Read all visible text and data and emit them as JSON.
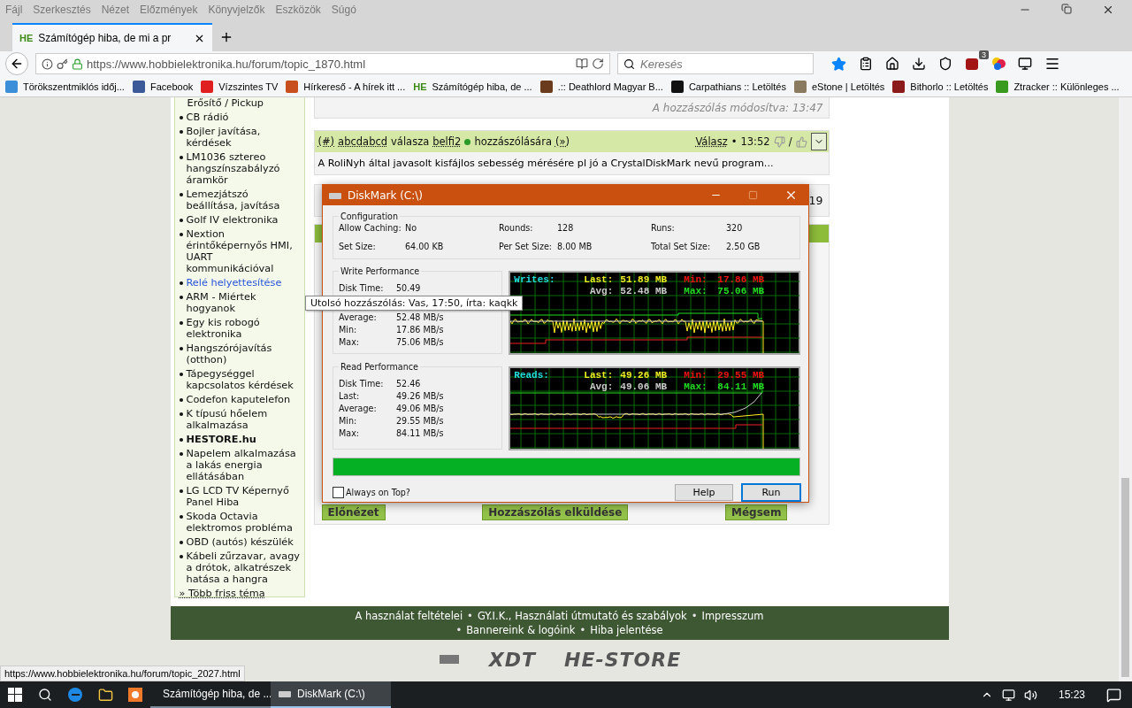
{
  "menu": [
    "Fájl",
    "Szerkesztés",
    "Nézet",
    "Előzmények",
    "Könyvjelzők",
    "Eszközök",
    "Súgó"
  ],
  "tabs": [
    {
      "label": "Számítógép hiba, de mi a pr",
      "favicon": "HE",
      "selected": true
    }
  ],
  "address": {
    "value": "https://www.hobbielektronika.hu/forum/topic_1870.html"
  },
  "search": {
    "placeholder": "Keresés"
  },
  "addon_badge": "3",
  "bookmarks": [
    {
      "label": "Törökszentmiklós időj...",
      "color": "#3b8fd9"
    },
    {
      "label": "Facebook",
      "color": "#3b5998"
    },
    {
      "label": "Vízszintes TV",
      "color": "#e02020"
    },
    {
      "label": "Hírkereső - A hírek itt ...",
      "color": "#c8501e"
    },
    {
      "label": "Számítógép hiba, de ...",
      "favicon": "HE"
    },
    {
      "label": ".:: Deathlord Magyar B...",
      "color": "#6b3b1e"
    },
    {
      "label": "Carpathians :: Letöltés",
      "color": "#111111"
    },
    {
      "label": "eStone | Letöltés",
      "color": "#8a7a60"
    },
    {
      "label": "Bithorlo :: Letöltés",
      "color": "#8b1a1a"
    },
    {
      "label": "Ztracker :: Különleges ...",
      "color": "#3a9a20"
    }
  ],
  "sidebar": {
    "items": [
      {
        "label": "Erősítő / Pickup",
        "kind": "continued"
      },
      {
        "label": "CB rádió",
        "kind": "topic"
      },
      {
        "label": "Bojler javítása, kérdések",
        "kind": "topic"
      },
      {
        "label": "LM1036 sztereo hangszínszabályzó áramkör",
        "kind": "topic"
      },
      {
        "label": "Lemezjátszó beállítása, javítása",
        "kind": "topic"
      },
      {
        "label": "Golf IV elektronika",
        "kind": "topic"
      },
      {
        "label": "Nextion érintőképernyős HMI, UART kommunikációval",
        "kind": "topic"
      },
      {
        "label": "Relé helyettesítése",
        "kind": "hovered"
      },
      {
        "label": "ARM - Miértek hogyanok",
        "kind": "topic"
      },
      {
        "label": "Egy kis robogó elektronika",
        "kind": "topic"
      },
      {
        "label": "Hangszórójavítás (otthon)",
        "kind": "topic"
      },
      {
        "label": "Tápegységgel kapcsolatos kérdések",
        "kind": "topic"
      },
      {
        "label": "Codefon kaputelefon",
        "kind": "topic"
      },
      {
        "label": "K típusú hőelem alkalmazása",
        "kind": "topic"
      },
      {
        "label": "HESTORE.hu",
        "kind": "bold"
      },
      {
        "label": "Napelem alkalmazása a lakás energia ellátásában",
        "kind": "topic"
      },
      {
        "label": "LG LCD TV Képernyő Panel Hiba",
        "kind": "topic"
      },
      {
        "label": "Skoda Octavia elektromos probléma",
        "kind": "topic"
      },
      {
        "label": "OBD (autós) készülék",
        "kind": "topic"
      },
      {
        "label": "Kábeli zűrzavar, avagy a drótok, alkatrészek hatása a hangra",
        "kind": "topic"
      }
    ],
    "more": "» Több friss téma"
  },
  "post_1": {
    "modified": "A hozzászólás módosítva: 13:47"
  },
  "post_2": {
    "anchor": "(#)",
    "author": "abcdabcd",
    "reply_word": "válasza",
    "target": "belfi2",
    "online": true,
    "target_word": "hozzászólására",
    "jump": "(»)",
    "reply_link": "Válasz",
    "separator": "•",
    "time": "13:52",
    "vote_separator": "/",
    "body": "A RoliNyh által javasolt kisfájlos sebesség mérésére pl jó a CrystalDiskMark nevű program..."
  },
  "post_3": {
    "time_fragment": "19"
  },
  "form_buttons": [
    "Előnézet",
    "Hozzászólás elküldése",
    "Mégsem"
  ],
  "tooltip": "Utolsó hozzászólás: Vas, 17:50, írta: kaqkk",
  "footer": [
    [
      {
        "text": "A használat feltételei",
        "kind": "link"
      },
      {
        "text": "•",
        "kind": "separator"
      },
      {
        "text": "GY.I.K., Használati útmutató és szabályok",
        "kind": "link"
      },
      {
        "text": "•",
        "kind": "separator"
      },
      {
        "text": "Impresszum",
        "kind": "link"
      }
    ],
    [
      {
        "text": "•",
        "kind": "separator"
      },
      {
        "text": "Bannereink & logóink",
        "kind": "link"
      },
      {
        "text": "•",
        "kind": "separator"
      },
      {
        "text": "Hiba jelentése",
        "kind": "link"
      }
    ]
  ],
  "partner_logos": [
    "XDT",
    "HE-STORE"
  ],
  "status_url": "https://www.hobbielektronika.hu/forum/topic_2027.html",
  "diskmark": {
    "title": "DiskMark (C:\\)",
    "configuration": {
      "legend": "Configuration",
      "fields": [
        {
          "label": "Allow Caching:",
          "value": "No"
        },
        {
          "label": "Rounds:",
          "value": "128"
        },
        {
          "label": "Runs:",
          "value": "320"
        },
        {
          "label": "Set Size:",
          "value": "64.00 KB"
        },
        {
          "label": "Per Set Size:",
          "value": "8.00 MB"
        },
        {
          "label": "Total Set Size:",
          "value": "2.50 GB"
        }
      ]
    },
    "write": {
      "legend": "Write Performance",
      "stats": [
        {
          "label": "Disk Time:",
          "value": "50.49"
        },
        {
          "label": "Average:",
          "value": "52.48 MB/s"
        },
        {
          "label": "Min:",
          "value": "17.86 MB/s"
        },
        {
          "label": "Max:",
          "value": "75.06 MB/s"
        }
      ],
      "graph": {
        "label": "Writes:",
        "last_label": "Last:",
        "last": "51.89 MB",
        "min_label": "Min:",
        "min": "17.86 MB",
        "avg_label": "Avg:",
        "avg": "52.48 MB",
        "max_label": "Max:",
        "max": "75.06 MB"
      }
    },
    "read": {
      "legend": "Read Performance",
      "stats": [
        {
          "label": "Disk Time:",
          "value": "52.46"
        },
        {
          "label": "Last:",
          "value": "49.26 MB/s"
        },
        {
          "label": "Average:",
          "value": "49.06 MB/s"
        },
        {
          "label": "Min:",
          "value": "29.55 MB/s"
        },
        {
          "label": "Max:",
          "value": "84.11 MB/s"
        }
      ],
      "graph": {
        "label": "Reads:",
        "last_label": "Last:",
        "last": "49.26 MB",
        "min_label": "Min:",
        "min": "29.55 MB",
        "avg_label": "Avg:",
        "avg": "49.06 MB",
        "max_label": "Max:",
        "max": "84.11 MB"
      }
    },
    "progress": {
      "level": 1
    },
    "always_on_top": {
      "label": "Always on Top?",
      "checked": false
    },
    "buttons": [
      {
        "label": "Help",
        "selected": false
      },
      {
        "label": "Run",
        "selected": true
      }
    ]
  },
  "taskbar": {
    "windows": [
      {
        "label": "Számítógép hiba, de ...",
        "kind": "browser",
        "selected": false
      },
      {
        "label": "DiskMark (C:\\)",
        "kind": "disk",
        "selected": true
      }
    ],
    "clock": "15:23"
  }
}
